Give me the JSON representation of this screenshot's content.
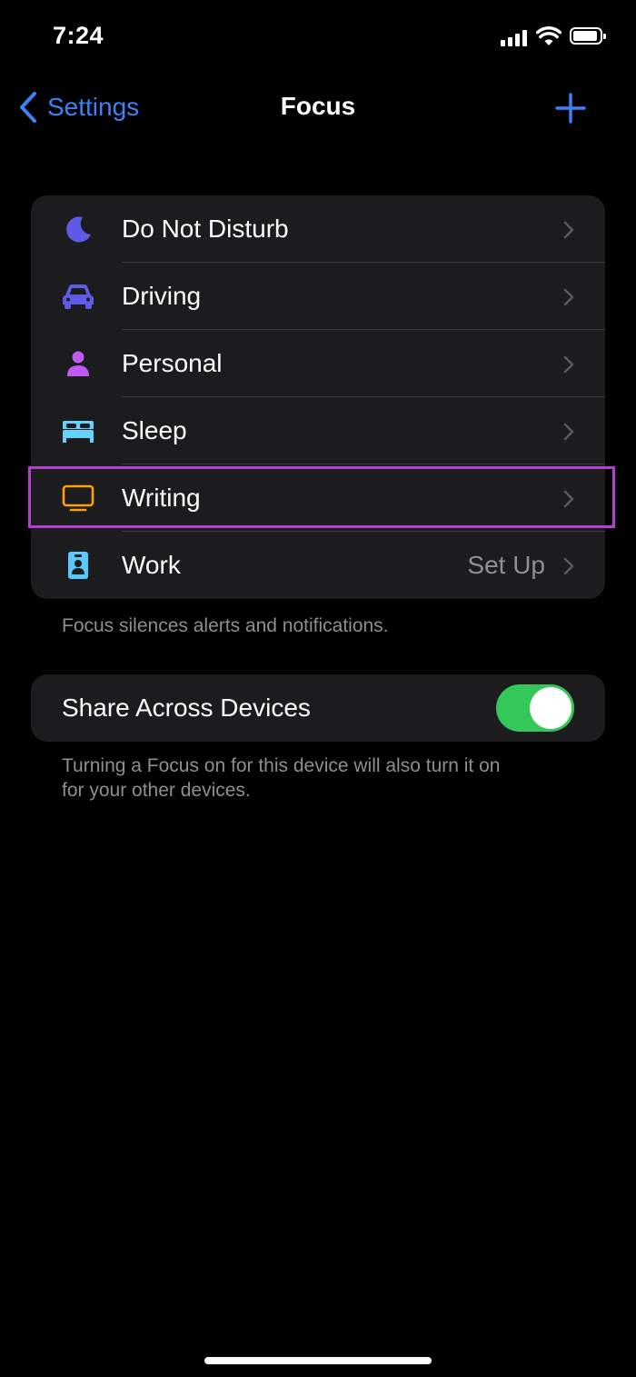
{
  "status_bar": {
    "time": "7:24"
  },
  "nav": {
    "back_label": "Settings",
    "title": "Focus"
  },
  "focus_list": {
    "items": [
      {
        "label": "Do Not Disturb",
        "value": "",
        "icon": "moon-icon",
        "color": "#5e5ce6"
      },
      {
        "label": "Driving",
        "value": "",
        "icon": "car-icon",
        "color": "#5e5ce6"
      },
      {
        "label": "Personal",
        "value": "",
        "icon": "person-icon",
        "color": "#bf5af2"
      },
      {
        "label": "Sleep",
        "value": "",
        "icon": "bed-icon",
        "color": "#64d2ff"
      },
      {
        "label": "Writing",
        "value": "",
        "icon": "monitor-icon",
        "color": "#ff9f0a",
        "highlighted": true
      },
      {
        "label": "Work",
        "value": "Set Up",
        "icon": "id-badge-icon",
        "color": "#5ac8fa"
      }
    ],
    "footer": "Focus silences alerts and notifications."
  },
  "share": {
    "label": "Share Across Devices",
    "enabled": true,
    "footer_line1": "Turning a Focus on for this device will also turn it on",
    "footer_line2": "for your other devices."
  },
  "colors": {
    "accent": "#3c82f6",
    "toggle_on": "#34c759",
    "highlight": "#b43fd1"
  }
}
